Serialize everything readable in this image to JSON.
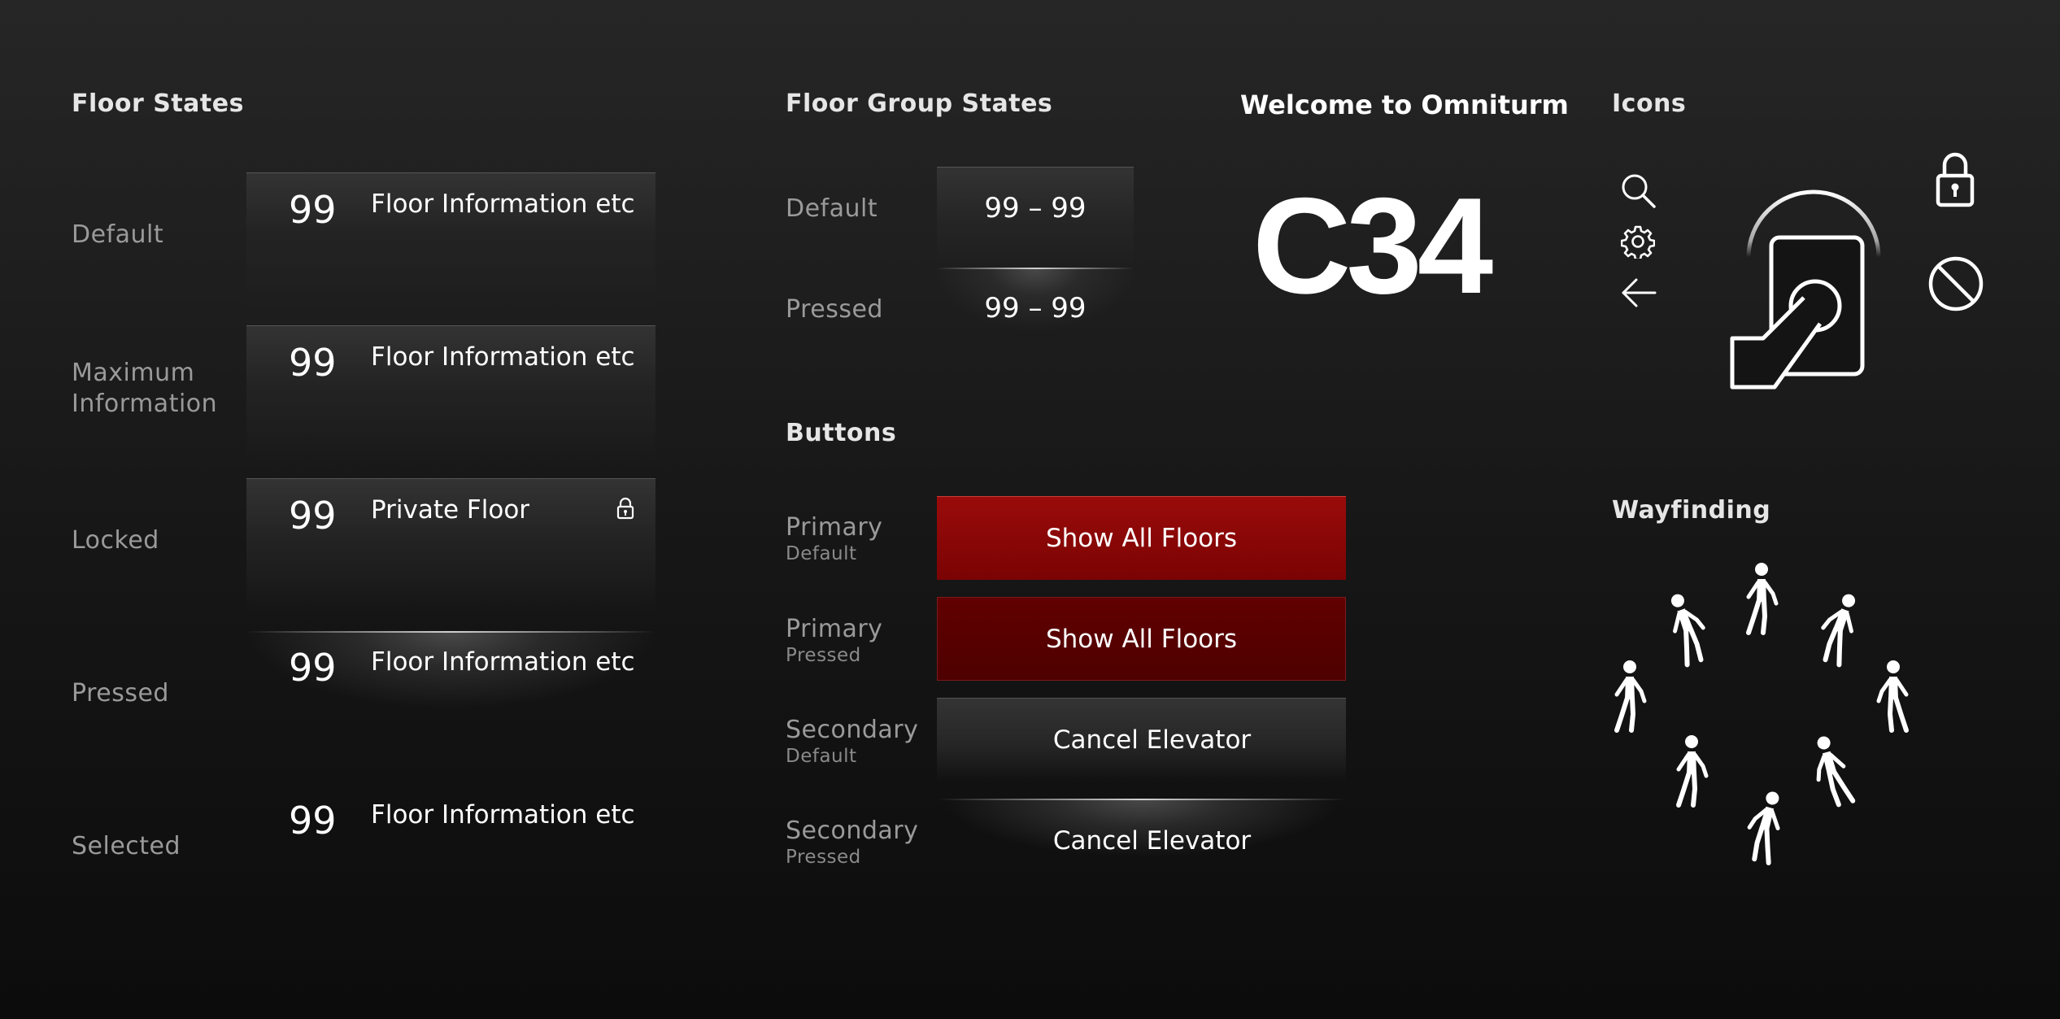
{
  "colors": {
    "primary_default": "#8f0808",
    "primary_pressed": "#570000",
    "background": "#1a1a1a",
    "label": "#9a9a9a",
    "text": "#ffffff"
  },
  "floor_states": {
    "title": "Floor States",
    "rows": [
      {
        "label": "Default",
        "number": "99",
        "info": "Floor Information etc"
      },
      {
        "label": "Maximum Information",
        "number": "99",
        "info": "Floor Information etc"
      },
      {
        "label": "Locked",
        "number": "99",
        "info": "Private Floor",
        "icon": "lock-icon"
      },
      {
        "label": "Pressed",
        "number": "99",
        "info": "Floor Information etc"
      },
      {
        "label": "Selected",
        "number": "99",
        "info": "Floor Information etc"
      }
    ]
  },
  "floor_group_states": {
    "title": "Floor Group States",
    "rows": [
      {
        "label": "Default",
        "value": "99 – 99"
      },
      {
        "label": "Pressed",
        "value": "99 – 99"
      }
    ]
  },
  "buttons": {
    "title": "Buttons",
    "rows": [
      {
        "label": "Primary",
        "state": "Default",
        "text": "Show All Floors"
      },
      {
        "label": "Primary",
        "state": "Pressed",
        "text": "Show All Floors"
      },
      {
        "label": "Secondary",
        "state": "Default",
        "text": "Cancel Elevator"
      },
      {
        "label": "Secondary",
        "state": "Pressed",
        "text": "Cancel Elevator"
      }
    ]
  },
  "welcome": {
    "title": "Welcome to Omniturm",
    "code": "C34"
  },
  "icons": {
    "title": "Icons",
    "items": [
      "search-icon",
      "gear-icon",
      "arrow-left-icon",
      "tap-card-icon",
      "lock-icon",
      "no-entry-icon"
    ]
  },
  "wayfinding": {
    "title": "Wayfinding",
    "items": [
      "walking-person-icon"
    ]
  }
}
